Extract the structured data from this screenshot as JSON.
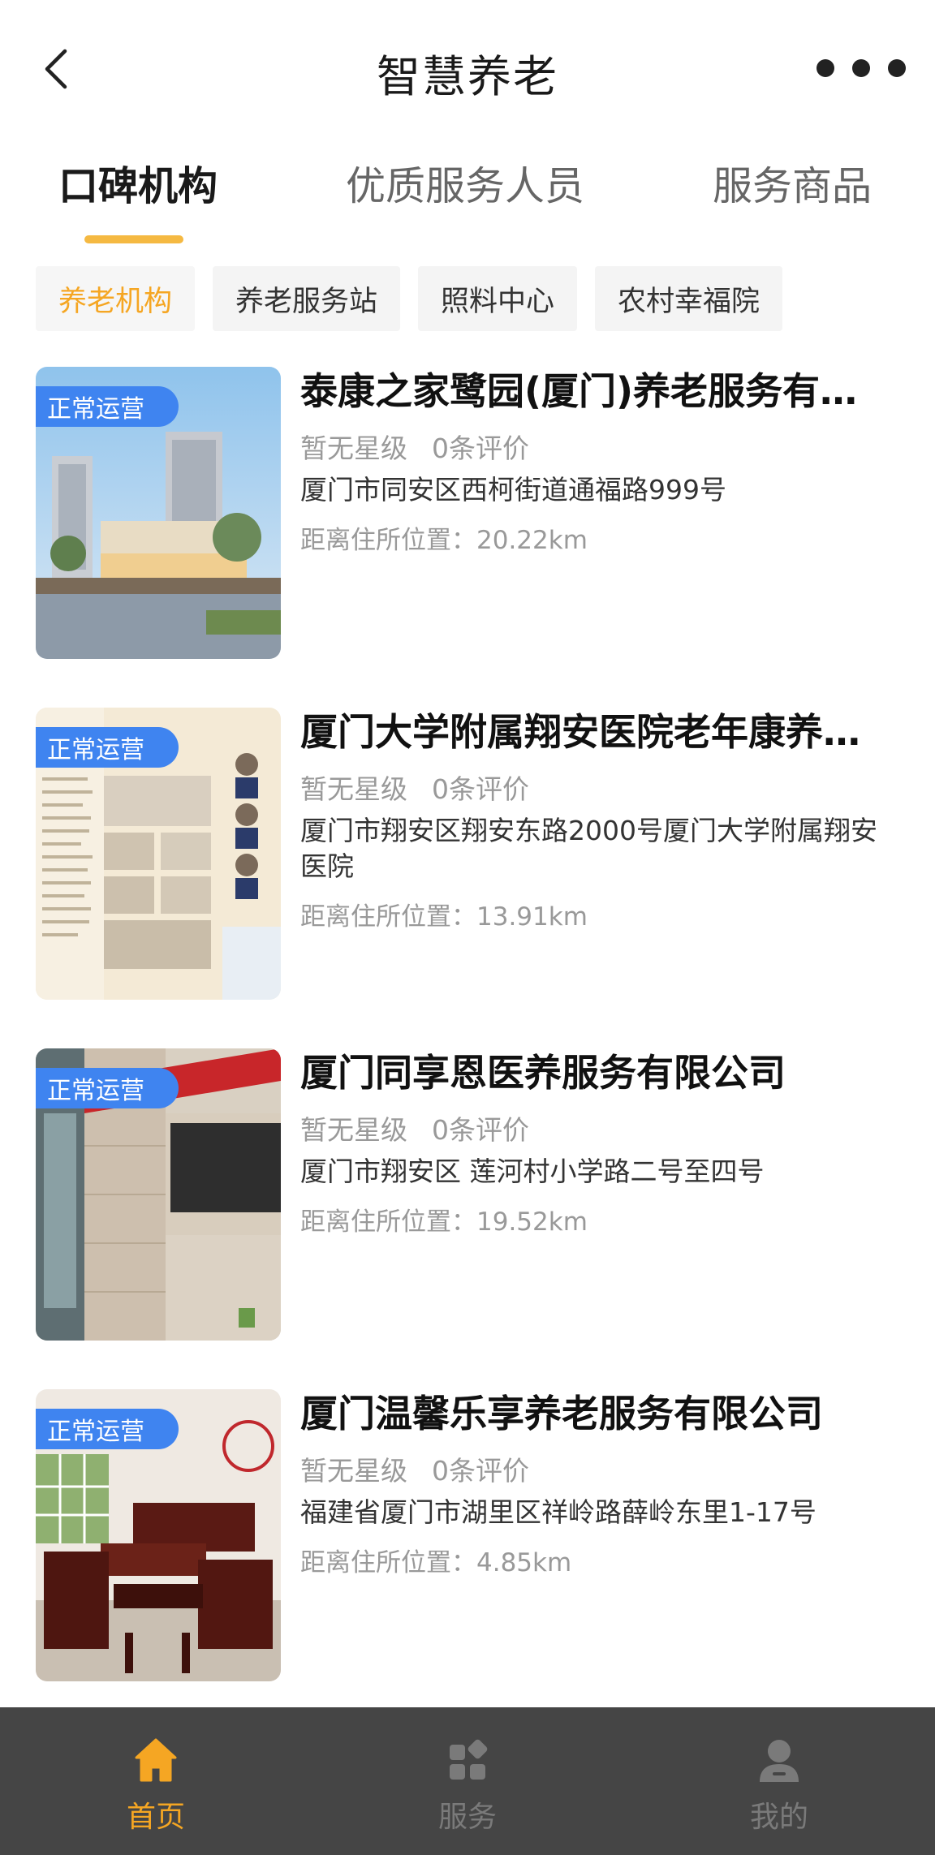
{
  "header": {
    "title": "智慧养老"
  },
  "main_tabs": [
    {
      "label": "口碑机构",
      "active": true
    },
    {
      "label": "优质服务人员",
      "active": false
    },
    {
      "label": "服务商品",
      "active": false
    }
  ],
  "chips": [
    {
      "label": "养老机构",
      "active": true
    },
    {
      "label": "养老服务站",
      "active": false
    },
    {
      "label": "照料中心",
      "active": false
    },
    {
      "label": "农村幸福院",
      "active": false
    }
  ],
  "institutions": [
    {
      "status": "正常运营",
      "name": "泰康之家鹭园(厦门)养老服务有限公司",
      "rating": "暂无星级",
      "reviews": "0条评价",
      "address": "厦门市同安区西柯街道通福路999号",
      "distance": "距离住所位置：20.22km"
    },
    {
      "status": "正常运营",
      "name": "厦门大学附属翔安医院老年康养中心",
      "rating": "暂无星级",
      "reviews": "0条评价",
      "address": "厦门市翔安区翔安东路2000号厦门大学附属翔安医院",
      "distance": "距离住所位置：13.91km"
    },
    {
      "status": "正常运营",
      "name": "厦门同享恩医养服务有限公司",
      "rating": "暂无星级",
      "reviews": "0条评价",
      "address": "厦门市翔安区 莲河村小学路二号至四号",
      "distance": "距离住所位置：19.52km"
    },
    {
      "status": "正常运营",
      "name": "厦门温馨乐享养老服务有限公司",
      "rating": "暂无星级",
      "reviews": "0条评价",
      "address": "福建省厦门市湖里区祥岭路薛岭东里1-17号",
      "distance": "距离住所位置：4.85km"
    }
  ],
  "bottom_nav": [
    {
      "label": "首页",
      "icon": "home-icon",
      "active": true
    },
    {
      "label": "服务",
      "icon": "grid-icon",
      "active": false
    },
    {
      "label": "我的",
      "icon": "user-icon",
      "active": false
    }
  ],
  "colors": {
    "accent": "#F5A623",
    "badge": "#3F84F0",
    "nav_bg": "#454545"
  }
}
